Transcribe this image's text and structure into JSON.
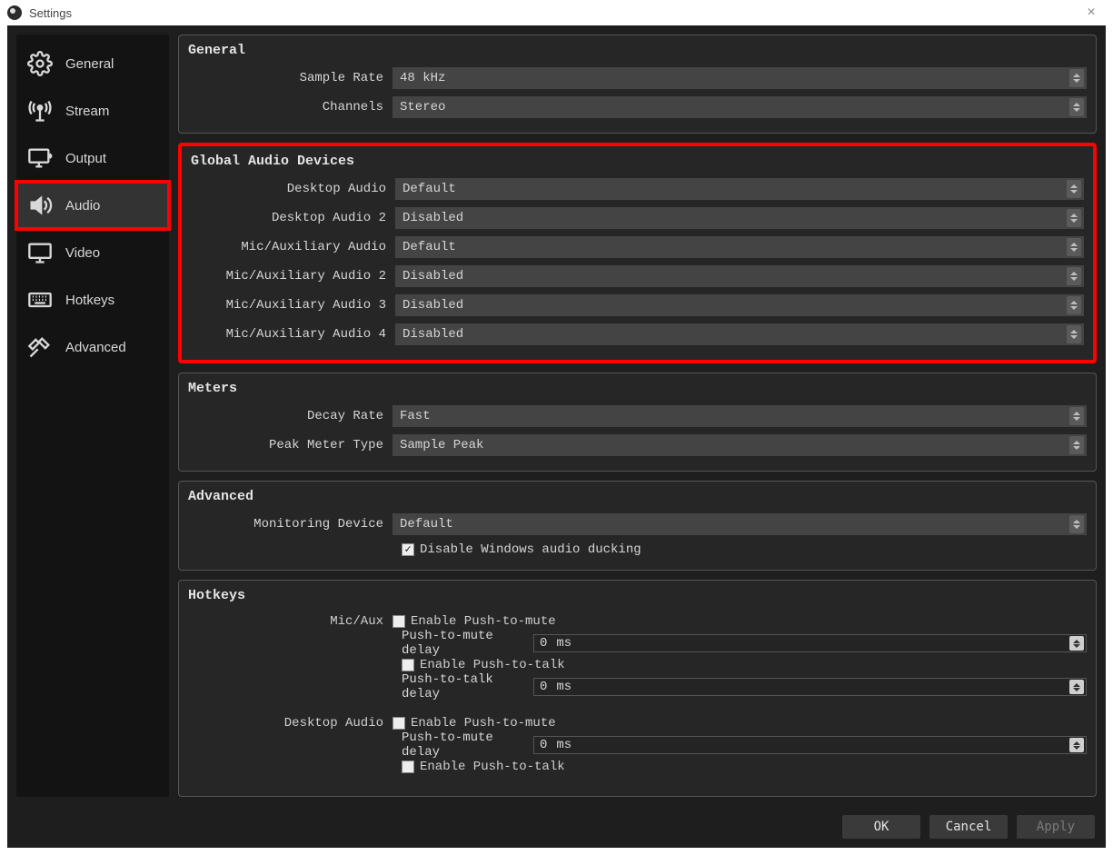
{
  "window": {
    "title": "Settings"
  },
  "sidebar": {
    "items": [
      {
        "label": "General"
      },
      {
        "label": "Stream"
      },
      {
        "label": "Output"
      },
      {
        "label": "Audio"
      },
      {
        "label": "Video"
      },
      {
        "label": "Hotkeys"
      },
      {
        "label": "Advanced"
      }
    ]
  },
  "general": {
    "title": "General",
    "sample_rate_label": "Sample Rate",
    "sample_rate_value": "48 kHz",
    "channels_label": "Channels",
    "channels_value": "Stereo"
  },
  "devices": {
    "title": "Global Audio Devices",
    "rows": [
      {
        "label": "Desktop Audio",
        "value": "Default"
      },
      {
        "label": "Desktop Audio 2",
        "value": "Disabled"
      },
      {
        "label": "Mic/Auxiliary Audio",
        "value": "Default"
      },
      {
        "label": "Mic/Auxiliary Audio 2",
        "value": "Disabled"
      },
      {
        "label": "Mic/Auxiliary Audio 3",
        "value": "Disabled"
      },
      {
        "label": "Mic/Auxiliary Audio 4",
        "value": "Disabled"
      }
    ]
  },
  "meters": {
    "title": "Meters",
    "decay_label": "Decay Rate",
    "decay_value": "Fast",
    "peak_label": "Peak Meter Type",
    "peak_value": "Sample Peak"
  },
  "advanced": {
    "title": "Advanced",
    "monitor_label": "Monitoring Device",
    "monitor_value": "Default",
    "duck_label": "Disable Windows audio ducking"
  },
  "hotkeys": {
    "title": "Hotkeys",
    "mic_label": "Mic/Aux",
    "desktop_label": "Desktop Audio",
    "ptm_enable": "Enable Push-to-mute",
    "ptm_delay_label": "Push-to-mute delay",
    "ptt_enable": "Enable Push-to-talk",
    "ptt_delay_label": "Push-to-talk delay",
    "delay_value": "0",
    "delay_unit": "ms"
  },
  "footer": {
    "ok": "OK",
    "cancel": "Cancel",
    "apply": "Apply"
  }
}
